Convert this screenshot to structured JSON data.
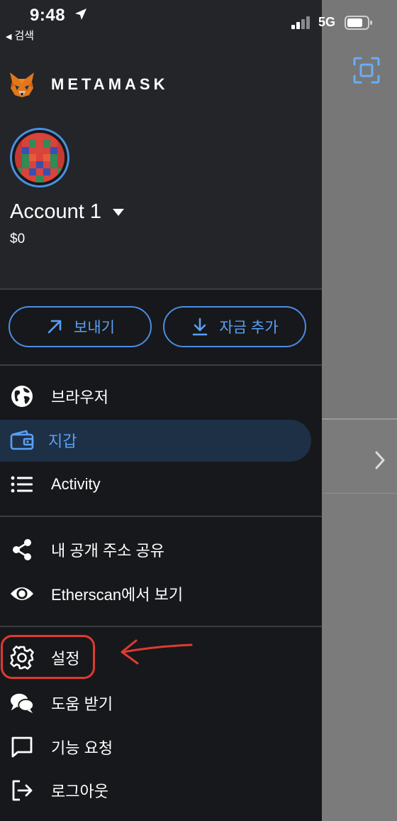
{
  "status_bar": {
    "time": "9:48",
    "back_label": "검색",
    "network": "5G"
  },
  "brand": {
    "name": "METAMASK"
  },
  "account": {
    "name": "Account 1",
    "balance": "$0"
  },
  "actions": {
    "send_label": "보내기",
    "add_funds_label": "자금 추가"
  },
  "menu": {
    "primary": [
      {
        "label": "브라우저",
        "icon": "globe-icon"
      },
      {
        "label": "지갑",
        "icon": "wallet-icon",
        "selected": true
      },
      {
        "label": "Activity",
        "icon": "list-icon"
      }
    ],
    "secondary": [
      {
        "label": "내 공개 주소 공유",
        "icon": "share-icon"
      },
      {
        "label": "Etherscan에서 보기",
        "icon": "eye-icon"
      }
    ],
    "tertiary": [
      {
        "label": "설정",
        "icon": "gear-icon"
      },
      {
        "label": "도움 받기",
        "icon": "chat-bubbles-icon"
      },
      {
        "label": "기능 요청",
        "icon": "message-icon"
      },
      {
        "label": "로그아웃",
        "icon": "logout-icon"
      }
    ]
  },
  "colors": {
    "accent": "#5aa0f5",
    "drawer_bg": "#17181b",
    "header_bg": "#232529",
    "selected_bg": "#1d3046",
    "annotation": "#e03a31"
  }
}
